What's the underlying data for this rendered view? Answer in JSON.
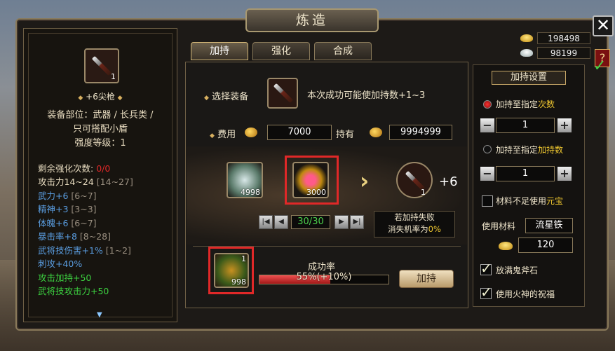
{
  "window": {
    "title": "炼造",
    "close_icon": "close-icon",
    "help_label": "?"
  },
  "currency": {
    "gold": "198498",
    "silver": "98199"
  },
  "tabs": [
    {
      "label": "加持",
      "active": true
    },
    {
      "label": "强化",
      "active": false
    },
    {
      "label": "合成",
      "active": false
    }
  ],
  "equipment": {
    "count": "1",
    "name": "+6尖枪",
    "slot_line": "装备部位：武器 / 长兵类 /",
    "restrict_line": "只可搭配小盾",
    "level_line": "强度等级：1",
    "stats": [
      {
        "label": "剩余强化次数:",
        "value": "0/0",
        "range": ""
      },
      {
        "label": "攻击力14~24",
        "value": "",
        "range": "[14~27]"
      },
      {
        "label": "武力+6",
        "value": "",
        "range": "[6~7]"
      },
      {
        "label": "精神+3",
        "value": "",
        "range": "[3~3]"
      },
      {
        "label": "体魄+6",
        "value": "",
        "range": "[6~7]"
      },
      {
        "label": "暴击率+8",
        "value": "",
        "range": "[8~28]"
      },
      {
        "label": "武将技伤害+1%",
        "value": "",
        "range": "[1~2]"
      },
      {
        "label": "刺攻+40%",
        "value": "",
        "range": ""
      },
      {
        "label": "攻击加持+50",
        "value": "",
        "range": ""
      },
      {
        "label": "武将技攻击力+50",
        "value": "",
        "range": ""
      }
    ]
  },
  "enhance": {
    "select_label": "选择装备",
    "select_hint": "本次成功可能使加持数+1~3",
    "cost_label": "费用",
    "cost_value": "7000",
    "owned_label": "持有",
    "owned_value": "9994999",
    "material1_count": "4998",
    "material2_count": "3000",
    "result_count": "1",
    "result_bonus": "+6",
    "page": "30/30",
    "fail_line1": "若加持失败",
    "fail_line2_prefix": "消失机率为",
    "fail_line2_value": "0%",
    "charm_count": "1",
    "charm_stock": "998",
    "success_label": "成功率",
    "success_text": "55%(+10%)",
    "success_rate": 0.55,
    "button": "加持"
  },
  "settings": {
    "title": "加持设置",
    "option1_prefix": "加持至指定",
    "option1_suffix": "次数",
    "option1_value": "1",
    "option2_prefix": "加持至指定",
    "option2_suffix": "加持数",
    "option2_value": "1",
    "use_ingot_prefix": "材料不足使用",
    "use_ingot_suffix": "元宝",
    "material_label": "使用材料",
    "material_value": "流星铁",
    "ingot_value": "120",
    "fill_stone": "放满鬼斧石",
    "fire_bless": "使用火神的祝福"
  }
}
